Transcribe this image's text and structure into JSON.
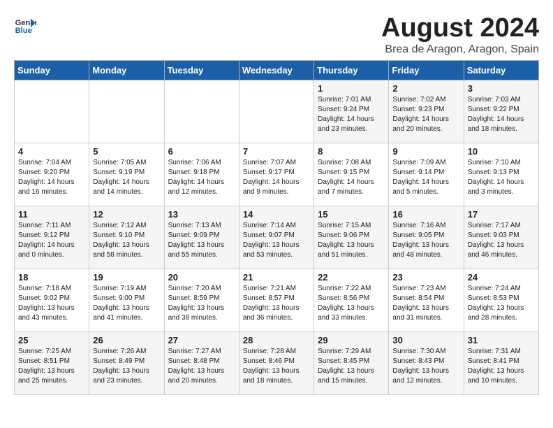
{
  "header": {
    "logo_general": "General",
    "logo_blue": "Blue",
    "month_title": "August 2024",
    "location": "Brea de Aragon, Aragon, Spain"
  },
  "days_of_week": [
    "Sunday",
    "Monday",
    "Tuesday",
    "Wednesday",
    "Thursday",
    "Friday",
    "Saturday"
  ],
  "weeks": [
    [
      {
        "day": "",
        "content": ""
      },
      {
        "day": "",
        "content": ""
      },
      {
        "day": "",
        "content": ""
      },
      {
        "day": "",
        "content": ""
      },
      {
        "day": "1",
        "content": "Sunrise: 7:01 AM\nSunset: 9:24 PM\nDaylight: 14 hours\nand 23 minutes."
      },
      {
        "day": "2",
        "content": "Sunrise: 7:02 AM\nSunset: 9:23 PM\nDaylight: 14 hours\nand 20 minutes."
      },
      {
        "day": "3",
        "content": "Sunrise: 7:03 AM\nSunset: 9:22 PM\nDaylight: 14 hours\nand 18 minutes."
      }
    ],
    [
      {
        "day": "4",
        "content": "Sunrise: 7:04 AM\nSunset: 9:20 PM\nDaylight: 14 hours\nand 16 minutes."
      },
      {
        "day": "5",
        "content": "Sunrise: 7:05 AM\nSunset: 9:19 PM\nDaylight: 14 hours\nand 14 minutes."
      },
      {
        "day": "6",
        "content": "Sunrise: 7:06 AM\nSunset: 9:18 PM\nDaylight: 14 hours\nand 12 minutes."
      },
      {
        "day": "7",
        "content": "Sunrise: 7:07 AM\nSunset: 9:17 PM\nDaylight: 14 hours\nand 9 minutes."
      },
      {
        "day": "8",
        "content": "Sunrise: 7:08 AM\nSunset: 9:15 PM\nDaylight: 14 hours\nand 7 minutes."
      },
      {
        "day": "9",
        "content": "Sunrise: 7:09 AM\nSunset: 9:14 PM\nDaylight: 14 hours\nand 5 minutes."
      },
      {
        "day": "10",
        "content": "Sunrise: 7:10 AM\nSunset: 9:13 PM\nDaylight: 14 hours\nand 3 minutes."
      }
    ],
    [
      {
        "day": "11",
        "content": "Sunrise: 7:11 AM\nSunset: 9:12 PM\nDaylight: 14 hours\nand 0 minutes."
      },
      {
        "day": "12",
        "content": "Sunrise: 7:12 AM\nSunset: 9:10 PM\nDaylight: 13 hours\nand 58 minutes."
      },
      {
        "day": "13",
        "content": "Sunrise: 7:13 AM\nSunset: 9:09 PM\nDaylight: 13 hours\nand 55 minutes."
      },
      {
        "day": "14",
        "content": "Sunrise: 7:14 AM\nSunset: 9:07 PM\nDaylight: 13 hours\nand 53 minutes."
      },
      {
        "day": "15",
        "content": "Sunrise: 7:15 AM\nSunset: 9:06 PM\nDaylight: 13 hours\nand 51 minutes."
      },
      {
        "day": "16",
        "content": "Sunrise: 7:16 AM\nSunset: 9:05 PM\nDaylight: 13 hours\nand 48 minutes."
      },
      {
        "day": "17",
        "content": "Sunrise: 7:17 AM\nSunset: 9:03 PM\nDaylight: 13 hours\nand 46 minutes."
      }
    ],
    [
      {
        "day": "18",
        "content": "Sunrise: 7:18 AM\nSunset: 9:02 PM\nDaylight: 13 hours\nand 43 minutes."
      },
      {
        "day": "19",
        "content": "Sunrise: 7:19 AM\nSunset: 9:00 PM\nDaylight: 13 hours\nand 41 minutes."
      },
      {
        "day": "20",
        "content": "Sunrise: 7:20 AM\nSunset: 8:59 PM\nDaylight: 13 hours\nand 38 minutes."
      },
      {
        "day": "21",
        "content": "Sunrise: 7:21 AM\nSunset: 8:57 PM\nDaylight: 13 hours\nand 36 minutes."
      },
      {
        "day": "22",
        "content": "Sunrise: 7:22 AM\nSunset: 8:56 PM\nDaylight: 13 hours\nand 33 minutes."
      },
      {
        "day": "23",
        "content": "Sunrise: 7:23 AM\nSunset: 8:54 PM\nDaylight: 13 hours\nand 31 minutes."
      },
      {
        "day": "24",
        "content": "Sunrise: 7:24 AM\nSunset: 8:53 PM\nDaylight: 13 hours\nand 28 minutes."
      }
    ],
    [
      {
        "day": "25",
        "content": "Sunrise: 7:25 AM\nSunset: 8:51 PM\nDaylight: 13 hours\nand 25 minutes."
      },
      {
        "day": "26",
        "content": "Sunrise: 7:26 AM\nSunset: 8:49 PM\nDaylight: 13 hours\nand 23 minutes."
      },
      {
        "day": "27",
        "content": "Sunrise: 7:27 AM\nSunset: 8:48 PM\nDaylight: 13 hours\nand 20 minutes."
      },
      {
        "day": "28",
        "content": "Sunrise: 7:28 AM\nSunset: 8:46 PM\nDaylight: 13 hours\nand 18 minutes."
      },
      {
        "day": "29",
        "content": "Sunrise: 7:29 AM\nSunset: 8:45 PM\nDaylight: 13 hours\nand 15 minutes."
      },
      {
        "day": "30",
        "content": "Sunrise: 7:30 AM\nSunset: 8:43 PM\nDaylight: 13 hours\nand 12 minutes."
      },
      {
        "day": "31",
        "content": "Sunrise: 7:31 AM\nSunset: 8:41 PM\nDaylight: 13 hours\nand 10 minutes."
      }
    ]
  ]
}
